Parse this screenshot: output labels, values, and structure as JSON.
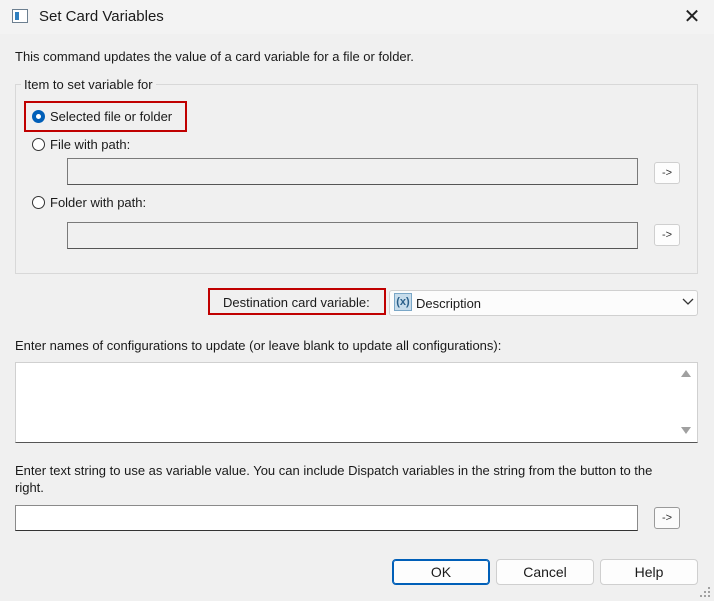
{
  "window": {
    "title": "Set Card Variables",
    "close_glyph": "✕"
  },
  "intro": "This command updates the value of a card variable for a file or folder.",
  "item_group": {
    "label": "Item to set variable for",
    "options": [
      {
        "label": "Selected file or folder",
        "checked": true
      },
      {
        "label": "File with path:",
        "checked": false
      },
      {
        "label": "Folder with path:",
        "checked": false
      }
    ],
    "file_path_value": "",
    "folder_path_value": "",
    "browse_label": "->"
  },
  "destination": {
    "label": "Destination card variable:",
    "value": "Description",
    "icon": "variable-icon",
    "icon_glyph": "(x)"
  },
  "configs": {
    "label": "Enter names of configurations to update (or leave blank to update all configurations):",
    "value": ""
  },
  "value_string": {
    "label_line1": "Enter text string to use as variable value. You can include Dispatch variables in the string from the button to the",
    "label_line2": "right.",
    "value": "",
    "insert_label": "->"
  },
  "buttons": {
    "ok": "OK",
    "cancel": "Cancel",
    "help": "Help"
  },
  "colors": {
    "highlight": "#c00000",
    "accent": "#005fb8"
  }
}
